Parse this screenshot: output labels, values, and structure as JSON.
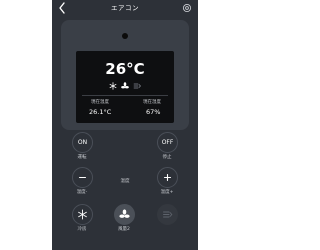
{
  "header": {
    "title": "エアコン",
    "back_icon": "chevron-left-icon",
    "settings_icon": "gear-icon"
  },
  "display": {
    "temperature": "26°C",
    "mode_icons": [
      "snowflake-icon",
      "fan-icon",
      "swing-icon"
    ],
    "stats": [
      {
        "label": "現在温度",
        "value": "26.1°C"
      },
      {
        "label": "現在湿度",
        "value": "67%"
      }
    ]
  },
  "controls": {
    "on": {
      "text": "ON",
      "label": "運転"
    },
    "off": {
      "text": "OFF",
      "label": "停止"
    },
    "temp_down": {
      "label": "温度-"
    },
    "temp_center_label": "温度",
    "temp_up": {
      "label": "温度+"
    },
    "cool": {
      "label": "冷房"
    },
    "fan": {
      "label": "風量2"
    }
  },
  "colors": {
    "background": "#2d3138",
    "card": "#3a3f47",
    "screen": "#0e0f11",
    "text": "#ffffff"
  }
}
